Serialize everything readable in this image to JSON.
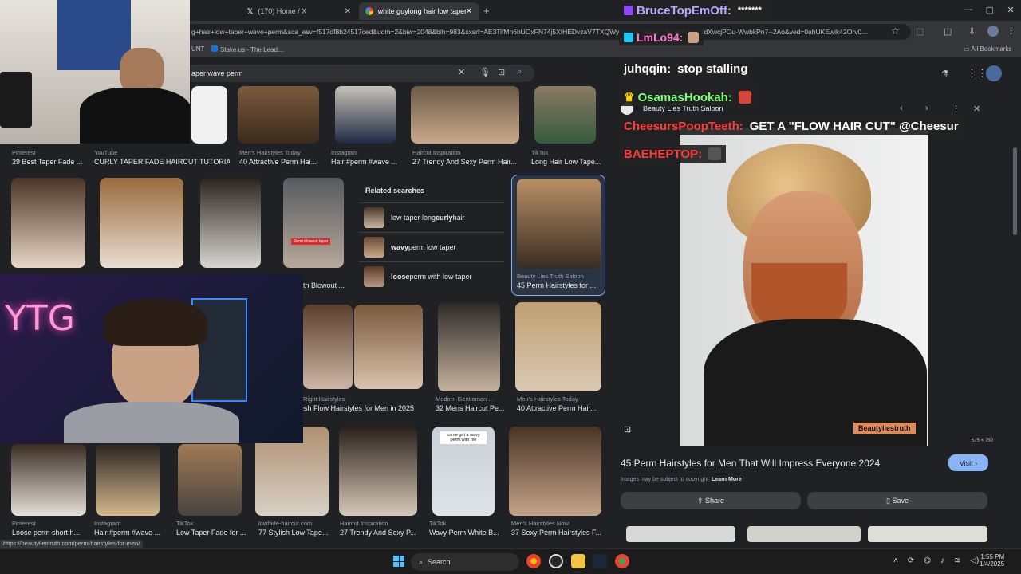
{
  "browser": {
    "tabs": [
      {
        "title": "(170) Home / X",
        "icon": "x-logo-icon"
      },
      {
        "title": "white guylong hair low taper w",
        "icon": "google-icon"
      }
    ],
    "new_tab": "+",
    "url": "g+hair+low+taper+wave+perm&sca_esv=f517df8b24517ced&udm=2&biw=2048&bih=983&sxsrf=AE3TifMn6hUOxFN74j5XIHEDvzaV7TXQWy5C1A1763182351964&ei=DdXwcjPOu-WwbkPn7--2Ao&ved=0ahUKEwik42Orv0...",
    "bookmarks": [
      "UNT",
      "Stake.us - The Leadi..."
    ],
    "all_bookmarks": "All Bookmarks"
  },
  "search": {
    "query": "aper wave perm"
  },
  "results_row1": [
    {
      "source": "Pinterest",
      "title": "29 Best Taper Fade ..."
    },
    {
      "source": "YouTube",
      "title": "CURLY TAPER FADE HAIRCUT TUTORIA..."
    },
    {
      "source": "Men's Hairstyles Today",
      "title": "40 Attractive Perm Hai..."
    },
    {
      "source": "Instagram",
      "title": "Hair #perm #wave ..."
    },
    {
      "source": "Haircut Inspiration",
      "title": "27 Trendy And Sexy Perm Hair..."
    },
    {
      "source": "TikTok",
      "title": "Long Hair Low Tape..."
    }
  ],
  "related": {
    "heading": "Related searches",
    "items": [
      {
        "pre": "low taper long ",
        "bold": "curly",
        "post": " hair"
      },
      {
        "pre": "",
        "bold": "wavy",
        "post": " perm low taper"
      },
      {
        "pre": "",
        "bold": "loose",
        "post": " perm with low taper"
      }
    ]
  },
  "selected_result": {
    "source": "Beauty Lies Truth Saloon",
    "title": "45 Perm Hairstyles for ..."
  },
  "results_row3": [
    {
      "source": "",
      "title": "th Blowout ..."
    },
    {
      "source": "Right Hairstyles",
      "title": "esh Flow Hairstyles for Men in 2025"
    },
    {
      "source": "Modern Gentleman ...",
      "title": "32 Mens Haircut Pe..."
    },
    {
      "source": "Men's Hairstyles Today",
      "title": "40 Attractive Perm Hair..."
    }
  ],
  "results_row4": [
    {
      "source": "Pinterest",
      "title": "Loose perm short h..."
    },
    {
      "source": "Instagram",
      "title": "Hair #perm #wave ..."
    },
    {
      "source": "TikTok",
      "title": "Low Taper Fade for ..."
    },
    {
      "source": "lowfade-haircut.com",
      "title": "77 Stylish Low Tape..."
    },
    {
      "source": "Haircut Inspiration",
      "title": "27 Trendy And Sexy P..."
    },
    {
      "source": "TikTok",
      "title": "Wavy Perm White B..."
    },
    {
      "source": "Men's Hairstyles Now",
      "title": "37 Sexy Perm Hairstyles F..."
    }
  ],
  "tiktok_caption": "come get a wavy perm with me",
  "panel_image_text": "Perm blowout taper",
  "status_url": "https://beautyliestruth.com/perm-hairstyles-for-men/",
  "side_panel": {
    "site": "Beauty Lies Truth Saloon",
    "title": "45 Perm Hairstyles for Men That Will Impress Everyone 2024",
    "visit": "Visit",
    "copyright": "Images may be subject to copyright.",
    "learn_more": "Learn More",
    "share": "Share",
    "save": "Save",
    "watermark": "Beautyliestruth",
    "dimensions": "575 × 750"
  },
  "stream_overlay": {
    "neon_sign": "YTG",
    "chat": [
      {
        "user": "BruceTopEmOff:",
        "message": "*******",
        "color": "#b9a6ff"
      },
      {
        "user": "LmLo94:",
        "message": "",
        "color": "#ff7bd4"
      },
      {
        "user": "juhqqin:",
        "message": "stop stalling",
        "color": "#ffffff"
      },
      {
        "user": "OsamasHookah:",
        "message": "",
        "color": "#7dff7a"
      },
      {
        "user": "CheesursPoopTeeth:",
        "message": "GET A \"FLOW HAIR CUT\" @Cheesur",
        "color": "#ff3b3b"
      },
      {
        "user": "BAEHEPTOP:",
        "message": "",
        "color": "#ff3b3b"
      }
    ]
  },
  "taskbar": {
    "search": "Search",
    "time": "1:55 PM",
    "date": "1/4/2025"
  },
  "colors": {
    "accent": "#8ab4f8",
    "bg": "#202124"
  }
}
